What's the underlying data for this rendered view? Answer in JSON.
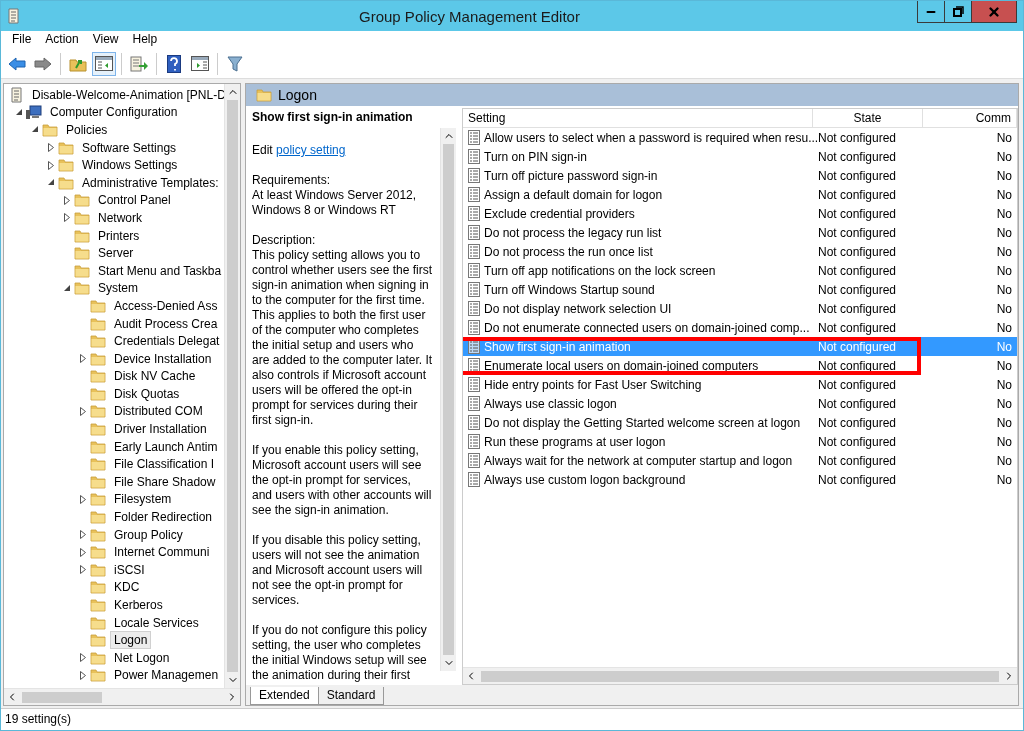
{
  "window": {
    "title": "Group Policy Management Editor"
  },
  "menu": [
    "File",
    "Action",
    "View",
    "Help"
  ],
  "toolbar": [
    {
      "kind": "back",
      "pressed": false
    },
    {
      "kind": "forward",
      "pressed": false
    },
    {
      "kind": "up",
      "pressed": false
    },
    {
      "kind": "tree",
      "pressed": true
    },
    {
      "kind": "export",
      "pressed": false
    },
    {
      "kind": "help",
      "pressed": false
    },
    {
      "kind": "pane",
      "pressed": false
    },
    {
      "kind": "filter",
      "pressed": false
    }
  ],
  "tree": [
    {
      "label": "Disable-Welcome-Animation [PNL-D",
      "kind": "gpo",
      "selected": false,
      "children": [
        {
          "label": "Computer Configuration",
          "kind": "computer",
          "expanded": true,
          "selected": false,
          "children": [
            {
              "label": "Policies",
              "kind": "folder",
              "expanded": true,
              "selected": false,
              "children": [
                {
                  "label": "Software Settings",
                  "kind": "folder",
                  "expanded": false,
                  "selected": false
                },
                {
                  "label": "Windows Settings",
                  "kind": "folder",
                  "expanded": false,
                  "selected": false
                },
                {
                  "label": "Administrative Templates:",
                  "kind": "folder",
                  "expanded": true,
                  "selected": false,
                  "children": [
                    {
                      "label": "Control Panel",
                      "kind": "folder",
                      "expanded": false,
                      "selected": false
                    },
                    {
                      "label": "Network",
                      "kind": "folder",
                      "expanded": false,
                      "selected": false
                    },
                    {
                      "label": "Printers",
                      "kind": "folder",
                      "selected": false
                    },
                    {
                      "label": "Server",
                      "kind": "folder",
                      "selected": false
                    },
                    {
                      "label": "Start Menu and Taskba",
                      "kind": "folder",
                      "selected": false
                    },
                    {
                      "label": "System",
                      "kind": "folder",
                      "expanded": true,
                      "selected": false,
                      "children": [
                        {
                          "label": "Access-Denied Ass",
                          "kind": "folder",
                          "selected": false
                        },
                        {
                          "label": "Audit Process Crea",
                          "kind": "folder",
                          "selected": false
                        },
                        {
                          "label": "Credentials Delegat",
                          "kind": "folder",
                          "selected": false
                        },
                        {
                          "label": "Device Installation",
                          "kind": "folder",
                          "expanded": false,
                          "selected": false
                        },
                        {
                          "label": "Disk NV Cache",
                          "kind": "folder",
                          "selected": false
                        },
                        {
                          "label": "Disk Quotas",
                          "kind": "folder",
                          "selected": false
                        },
                        {
                          "label": "Distributed COM",
                          "kind": "folder",
                          "expanded": false,
                          "selected": false
                        },
                        {
                          "label": "Driver Installation",
                          "kind": "folder",
                          "selected": false
                        },
                        {
                          "label": "Early Launch Antim",
                          "kind": "folder",
                          "selected": false
                        },
                        {
                          "label": "File Classification I",
                          "kind": "folder",
                          "selected": false
                        },
                        {
                          "label": "File Share Shadow",
                          "kind": "folder",
                          "selected": false
                        },
                        {
                          "label": "Filesystem",
                          "kind": "folder",
                          "expanded": false,
                          "selected": false
                        },
                        {
                          "label": "Folder Redirection",
                          "kind": "folder",
                          "selected": false
                        },
                        {
                          "label": "Group Policy",
                          "kind": "folder",
                          "expanded": false,
                          "selected": false
                        },
                        {
                          "label": "Internet Communi",
                          "kind": "folder",
                          "expanded": false,
                          "selected": false
                        },
                        {
                          "label": "iSCSI",
                          "kind": "folder",
                          "expanded": false,
                          "selected": false
                        },
                        {
                          "label": "KDC",
                          "kind": "folder",
                          "selected": false
                        },
                        {
                          "label": "Kerberos",
                          "kind": "folder",
                          "selected": false
                        },
                        {
                          "label": "Locale Services",
                          "kind": "folder",
                          "selected": false
                        },
                        {
                          "label": "Logon",
                          "kind": "folder",
                          "selected": true
                        },
                        {
                          "label": "Net Logon",
                          "kind": "folder",
                          "expanded": false,
                          "selected": false
                        },
                        {
                          "label": "Power Managemen",
                          "kind": "folder",
                          "expanded": false,
                          "selected": false
                        }
                      ]
                    }
                  ]
                }
              ]
            }
          ]
        }
      ]
    }
  ],
  "details": {
    "folder": "Logon",
    "title": "Show first sign-in animation",
    "edit_prefix": "Edit",
    "edit_link": "policy setting",
    "paragraphs": [
      [
        "Requirements:",
        "At least Windows Server 2012, Windows 8 or Windows RT"
      ],
      [
        "Description:",
        "This policy setting allows you to control whether users see the first sign-in animation when signing in to the computer for the first time.  This applies to both the first user of the computer who completes the initial setup and users who are added to the computer later.  It also controls if Microsoft account users will be offered the opt-in prompt for services during their first sign-in."
      ],
      [
        "If you enable this policy setting, Microsoft account users will see the opt-in prompt for services, and users with other accounts will see the sign-in animation."
      ],
      [
        "If you disable this policy setting, users will not see the animation and Microsoft account users will not see the opt-in prompt for services."
      ],
      [
        "If you do not configure this policy setting, the user who completes the initial Windows setup will see the animation during their first"
      ]
    ]
  },
  "table": {
    "columns": [
      "Setting",
      "State",
      "Comm"
    ],
    "rows": [
      {
        "setting": "Allow users to select when a password is required when resu...",
        "state": "Not configured",
        "comment": "No",
        "selected": false
      },
      {
        "setting": "Turn on PIN sign-in",
        "state": "Not configured",
        "comment": "No",
        "selected": false
      },
      {
        "setting": "Turn off picture password sign-in",
        "state": "Not configured",
        "comment": "No",
        "selected": false
      },
      {
        "setting": "Assign a default domain for logon",
        "state": "Not configured",
        "comment": "No",
        "selected": false
      },
      {
        "setting": "Exclude credential providers",
        "state": "Not configured",
        "comment": "No",
        "selected": false
      },
      {
        "setting": "Do not process the legacy run list",
        "state": "Not configured",
        "comment": "No",
        "selected": false
      },
      {
        "setting": "Do not process the run once list",
        "state": "Not configured",
        "comment": "No",
        "selected": false
      },
      {
        "setting": "Turn off app notifications on the lock screen",
        "state": "Not configured",
        "comment": "No",
        "selected": false
      },
      {
        "setting": "Turn off Windows Startup sound",
        "state": "Not configured",
        "comment": "No",
        "selected": false
      },
      {
        "setting": "Do not display network selection UI",
        "state": "Not configured",
        "comment": "No",
        "selected": false
      },
      {
        "setting": "Do not enumerate connected users on domain-joined comp...",
        "state": "Not configured",
        "comment": "No",
        "selected": false
      },
      {
        "setting": "Show first sign-in animation",
        "state": "Not configured",
        "comment": "No",
        "selected": true
      },
      {
        "setting": "Enumerate local users on domain-joined computers",
        "state": "Not configured",
        "comment": "No",
        "selected": false
      },
      {
        "setting": "Hide entry points for Fast User Switching",
        "state": "Not configured",
        "comment": "No",
        "selected": false
      },
      {
        "setting": "Always use classic logon",
        "state": "Not configured",
        "comment": "No",
        "selected": false
      },
      {
        "setting": "Do not display the Getting Started welcome screen at logon",
        "state": "Not configured",
        "comment": "No",
        "selected": false
      },
      {
        "setting": "Run these programs at user logon",
        "state": "Not configured",
        "comment": "No",
        "selected": false
      },
      {
        "setting": "Always wait for the network at computer startup and logon",
        "state": "Not configured",
        "comment": "No",
        "selected": false
      },
      {
        "setting": "Always use custom logon background",
        "state": "Not configured",
        "comment": "No",
        "selected": false
      }
    ]
  },
  "tabs": [
    {
      "label": "Extended",
      "selected": true
    },
    {
      "label": "Standard",
      "selected": false
    }
  ],
  "status_bar": "19 setting(s)"
}
